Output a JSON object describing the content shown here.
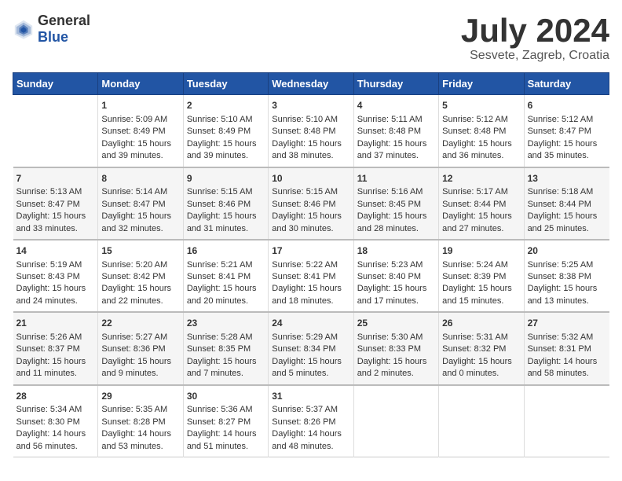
{
  "logo": {
    "general": "General",
    "blue": "Blue"
  },
  "title": "July 2024",
  "subtitle": "Sesvete, Zagreb, Croatia",
  "headers": [
    "Sunday",
    "Monday",
    "Tuesday",
    "Wednesday",
    "Thursday",
    "Friday",
    "Saturday"
  ],
  "weeks": [
    [
      {
        "day": "",
        "sunrise": "",
        "sunset": "",
        "daylight": ""
      },
      {
        "day": "1",
        "sunrise": "Sunrise: 5:09 AM",
        "sunset": "Sunset: 8:49 PM",
        "daylight": "Daylight: 15 hours and 39 minutes."
      },
      {
        "day": "2",
        "sunrise": "Sunrise: 5:10 AM",
        "sunset": "Sunset: 8:49 PM",
        "daylight": "Daylight: 15 hours and 39 minutes."
      },
      {
        "day": "3",
        "sunrise": "Sunrise: 5:10 AM",
        "sunset": "Sunset: 8:48 PM",
        "daylight": "Daylight: 15 hours and 38 minutes."
      },
      {
        "day": "4",
        "sunrise": "Sunrise: 5:11 AM",
        "sunset": "Sunset: 8:48 PM",
        "daylight": "Daylight: 15 hours and 37 minutes."
      },
      {
        "day": "5",
        "sunrise": "Sunrise: 5:12 AM",
        "sunset": "Sunset: 8:48 PM",
        "daylight": "Daylight: 15 hours and 36 minutes."
      },
      {
        "day": "6",
        "sunrise": "Sunrise: 5:12 AM",
        "sunset": "Sunset: 8:47 PM",
        "daylight": "Daylight: 15 hours and 35 minutes."
      }
    ],
    [
      {
        "day": "7",
        "sunrise": "Sunrise: 5:13 AM",
        "sunset": "Sunset: 8:47 PM",
        "daylight": "Daylight: 15 hours and 33 minutes."
      },
      {
        "day": "8",
        "sunrise": "Sunrise: 5:14 AM",
        "sunset": "Sunset: 8:47 PM",
        "daylight": "Daylight: 15 hours and 32 minutes."
      },
      {
        "day": "9",
        "sunrise": "Sunrise: 5:15 AM",
        "sunset": "Sunset: 8:46 PM",
        "daylight": "Daylight: 15 hours and 31 minutes."
      },
      {
        "day": "10",
        "sunrise": "Sunrise: 5:15 AM",
        "sunset": "Sunset: 8:46 PM",
        "daylight": "Daylight: 15 hours and 30 minutes."
      },
      {
        "day": "11",
        "sunrise": "Sunrise: 5:16 AM",
        "sunset": "Sunset: 8:45 PM",
        "daylight": "Daylight: 15 hours and 28 minutes."
      },
      {
        "day": "12",
        "sunrise": "Sunrise: 5:17 AM",
        "sunset": "Sunset: 8:44 PM",
        "daylight": "Daylight: 15 hours and 27 minutes."
      },
      {
        "day": "13",
        "sunrise": "Sunrise: 5:18 AM",
        "sunset": "Sunset: 8:44 PM",
        "daylight": "Daylight: 15 hours and 25 minutes."
      }
    ],
    [
      {
        "day": "14",
        "sunrise": "Sunrise: 5:19 AM",
        "sunset": "Sunset: 8:43 PM",
        "daylight": "Daylight: 15 hours and 24 minutes."
      },
      {
        "day": "15",
        "sunrise": "Sunrise: 5:20 AM",
        "sunset": "Sunset: 8:42 PM",
        "daylight": "Daylight: 15 hours and 22 minutes."
      },
      {
        "day": "16",
        "sunrise": "Sunrise: 5:21 AM",
        "sunset": "Sunset: 8:41 PM",
        "daylight": "Daylight: 15 hours and 20 minutes."
      },
      {
        "day": "17",
        "sunrise": "Sunrise: 5:22 AM",
        "sunset": "Sunset: 8:41 PM",
        "daylight": "Daylight: 15 hours and 18 minutes."
      },
      {
        "day": "18",
        "sunrise": "Sunrise: 5:23 AM",
        "sunset": "Sunset: 8:40 PM",
        "daylight": "Daylight: 15 hours and 17 minutes."
      },
      {
        "day": "19",
        "sunrise": "Sunrise: 5:24 AM",
        "sunset": "Sunset: 8:39 PM",
        "daylight": "Daylight: 15 hours and 15 minutes."
      },
      {
        "day": "20",
        "sunrise": "Sunrise: 5:25 AM",
        "sunset": "Sunset: 8:38 PM",
        "daylight": "Daylight: 15 hours and 13 minutes."
      }
    ],
    [
      {
        "day": "21",
        "sunrise": "Sunrise: 5:26 AM",
        "sunset": "Sunset: 8:37 PM",
        "daylight": "Daylight: 15 hours and 11 minutes."
      },
      {
        "day": "22",
        "sunrise": "Sunrise: 5:27 AM",
        "sunset": "Sunset: 8:36 PM",
        "daylight": "Daylight: 15 hours and 9 minutes."
      },
      {
        "day": "23",
        "sunrise": "Sunrise: 5:28 AM",
        "sunset": "Sunset: 8:35 PM",
        "daylight": "Daylight: 15 hours and 7 minutes."
      },
      {
        "day": "24",
        "sunrise": "Sunrise: 5:29 AM",
        "sunset": "Sunset: 8:34 PM",
        "daylight": "Daylight: 15 hours and 5 minutes."
      },
      {
        "day": "25",
        "sunrise": "Sunrise: 5:30 AM",
        "sunset": "Sunset: 8:33 PM",
        "daylight": "Daylight: 15 hours and 2 minutes."
      },
      {
        "day": "26",
        "sunrise": "Sunrise: 5:31 AM",
        "sunset": "Sunset: 8:32 PM",
        "daylight": "Daylight: 15 hours and 0 minutes."
      },
      {
        "day": "27",
        "sunrise": "Sunrise: 5:32 AM",
        "sunset": "Sunset: 8:31 PM",
        "daylight": "Daylight: 14 hours and 58 minutes."
      }
    ],
    [
      {
        "day": "28",
        "sunrise": "Sunrise: 5:34 AM",
        "sunset": "Sunset: 8:30 PM",
        "daylight": "Daylight: 14 hours and 56 minutes."
      },
      {
        "day": "29",
        "sunrise": "Sunrise: 5:35 AM",
        "sunset": "Sunset: 8:28 PM",
        "daylight": "Daylight: 14 hours and 53 minutes."
      },
      {
        "day": "30",
        "sunrise": "Sunrise: 5:36 AM",
        "sunset": "Sunset: 8:27 PM",
        "daylight": "Daylight: 14 hours and 51 minutes."
      },
      {
        "day": "31",
        "sunrise": "Sunrise: 5:37 AM",
        "sunset": "Sunset: 8:26 PM",
        "daylight": "Daylight: 14 hours and 48 minutes."
      },
      {
        "day": "",
        "sunrise": "",
        "sunset": "",
        "daylight": ""
      },
      {
        "day": "",
        "sunrise": "",
        "sunset": "",
        "daylight": ""
      },
      {
        "day": "",
        "sunrise": "",
        "sunset": "",
        "daylight": ""
      }
    ]
  ]
}
